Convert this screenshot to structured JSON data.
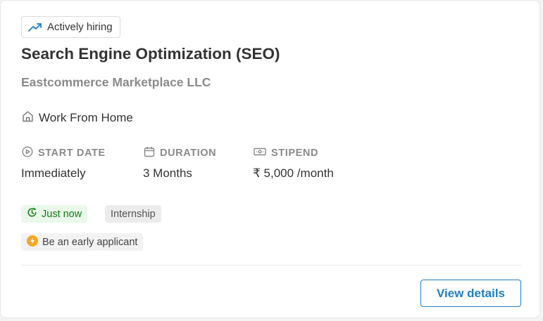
{
  "badge": {
    "label": "Actively hiring",
    "icon": "trending-up-icon",
    "icon_color": "#1f7ec2"
  },
  "job": {
    "title": "Search Engine Optimization (SEO)",
    "company": "Eastcommerce Marketplace LLC",
    "location": {
      "icon": "home-icon",
      "text": "Work From Home"
    }
  },
  "details": {
    "start": {
      "icon": "play-circle-icon",
      "label": "START DATE",
      "value": "Immediately"
    },
    "duration": {
      "icon": "calendar-icon",
      "label": "DURATION",
      "value": "3 Months"
    },
    "stipend": {
      "icon": "money-icon",
      "label": "STIPEND",
      "value": "₹ 5,000 /month"
    }
  },
  "tags": {
    "posted": {
      "icon": "clock-icon",
      "text": "Just now",
      "color": "#0f7a17",
      "bg": "#eaf8e9"
    },
    "type": {
      "text": "Internship"
    },
    "early": {
      "icon": "lightning-icon",
      "text": "Be an early applicant",
      "icon_color": "#f5a623"
    }
  },
  "actions": {
    "view_details": "View details",
    "accent": "#1f7ec2"
  }
}
